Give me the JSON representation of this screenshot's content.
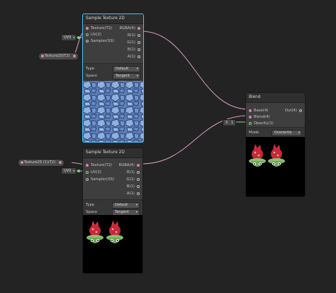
{
  "colors": {
    "background": "#232323",
    "node": "#393939",
    "selected": "#44c0ff",
    "wire_pink": "#d99ac1",
    "wire_green": "#8fcf9a"
  },
  "node1": {
    "title": "Sample Texture 2D",
    "inputs": [
      "Texture(T2)",
      "UV(2)",
      "Sampler(SS)"
    ],
    "outputs": [
      "RGBA(4)",
      "R(1)",
      "G(1)",
      "B(1)",
      "A(1)"
    ],
    "type_label": "Type",
    "type_value": "Default",
    "space_label": "Space",
    "space_value": "Tangent",
    "preview": "rocky blue texture"
  },
  "node2": {
    "title": "Sample Texture 2D",
    "inputs": [
      "Texture(T2)",
      "UV(2)",
      "Sampler(SS)"
    ],
    "outputs": [
      "RGBA(4)",
      "R(1)",
      "G(1)",
      "B(1)",
      "A(1)"
    ],
    "type_label": "Type",
    "type_value": "Default",
    "space_label": "Space",
    "space_value": "Tangent",
    "preview": "two cupcake characters"
  },
  "blend": {
    "title": "Blend",
    "inputs": [
      "Base(4)",
      "Blend(4)",
      "Opacity(1)"
    ],
    "output": "Out(4)",
    "mode_label": "Mode",
    "mode_value": "Overwrite",
    "preview": "two cupcake characters"
  },
  "prop1": {
    "label": "Texture2D(T2)"
  },
  "prop2": {
    "label": "Texture2D (1)(T2)"
  },
  "uv1": {
    "label": "UV0"
  },
  "uv2": {
    "label": "UV0"
  },
  "opacity": {
    "prefix": "X",
    "value": "1"
  }
}
